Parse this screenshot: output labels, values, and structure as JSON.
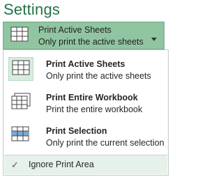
{
  "header": {
    "title": "Settings"
  },
  "print_what": {
    "selected": {
      "title": "Print Active Sheets",
      "subtitle": "Only print the active sheets"
    },
    "options": [
      {
        "title": "Print Active Sheets",
        "subtitle": "Only print the active sheets",
        "icon": "active-sheets-icon"
      },
      {
        "title": "Print Entire Workbook",
        "subtitle": "Print the entire workbook",
        "icon": "entire-workbook-icon"
      },
      {
        "title": "Print Selection",
        "subtitle": "Only print the current selection",
        "icon": "selection-icon"
      }
    ],
    "ignore_print_area": {
      "label": "Ignore Print Area",
      "checked": true,
      "check_glyph": "✓"
    }
  },
  "colors": {
    "accent": "#217346",
    "button_bg": "#91c5a2",
    "selected_bg": "#d8ecdf",
    "footer_bg": "#e6f1ea"
  }
}
